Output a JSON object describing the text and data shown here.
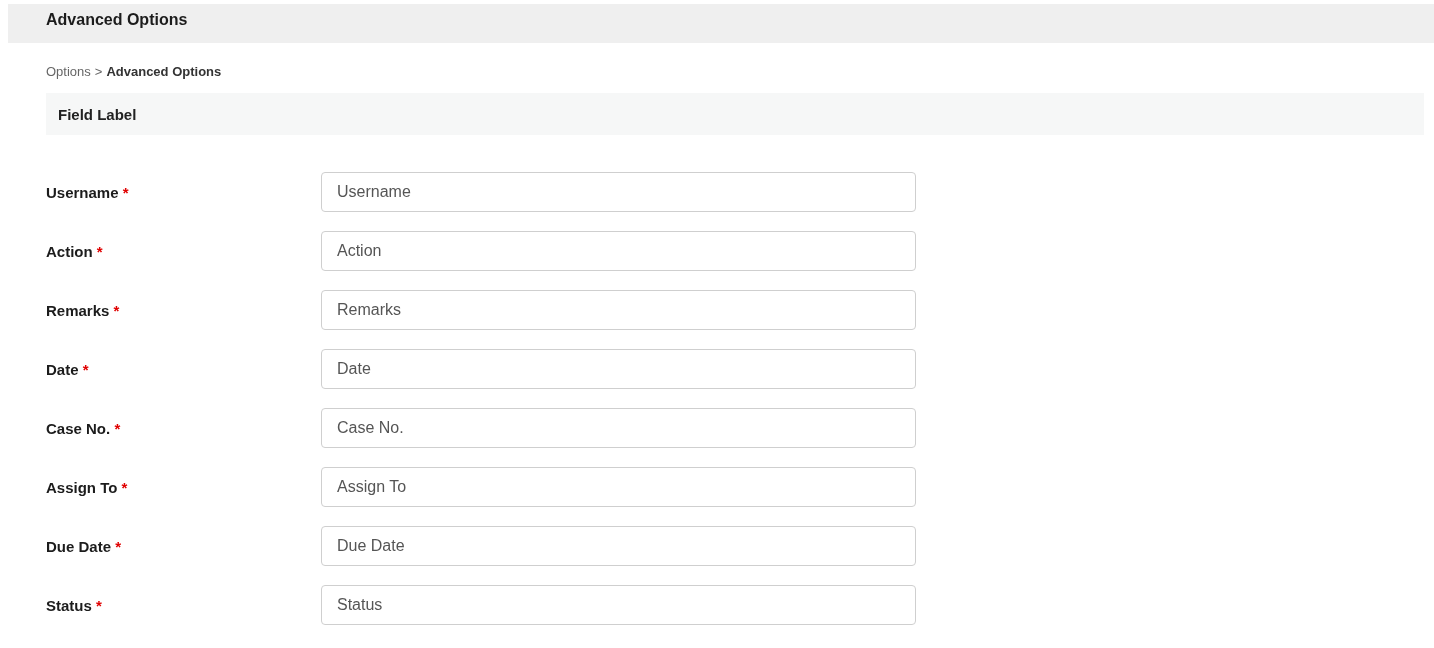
{
  "header": {
    "title": "Advanced Options"
  },
  "breadcrumb": {
    "items": [
      {
        "label": "Options",
        "current": false
      },
      {
        "label": "Advanced Options",
        "current": true
      }
    ],
    "separator": ">"
  },
  "section": {
    "title": "Field Label"
  },
  "fields": [
    {
      "label": "Username",
      "required": true,
      "value": "Username"
    },
    {
      "label": "Action",
      "required": true,
      "value": "Action"
    },
    {
      "label": "Remarks",
      "required": true,
      "value": "Remarks"
    },
    {
      "label": "Date",
      "required": true,
      "value": "Date"
    },
    {
      "label": "Case No.",
      "required": true,
      "value": "Case No."
    },
    {
      "label": "Assign To",
      "required": true,
      "value": "Assign To"
    },
    {
      "label": "Due Date",
      "required": true,
      "value": "Due Date"
    },
    {
      "label": "Status",
      "required": true,
      "value": "Status"
    }
  ],
  "required_mark": "*"
}
